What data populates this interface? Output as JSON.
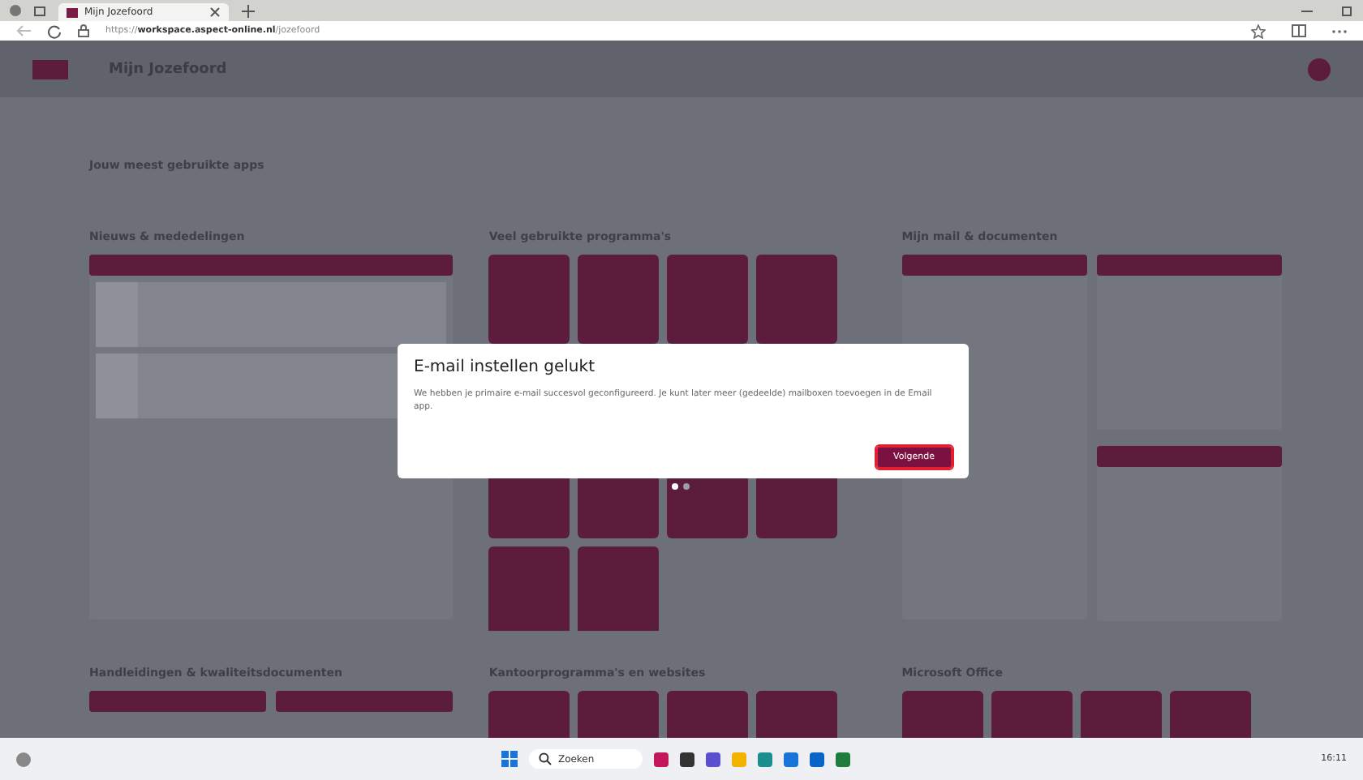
{
  "browser": {
    "tab_title": "Mijn Jozefoord",
    "url_prefix": "https://",
    "url_host": "workspace.aspect-online.nl",
    "url_path": "/jozefoord"
  },
  "app": {
    "title": "Mijn Jozefoord"
  },
  "favourites": {
    "heading": "Jouw meest gebruikte apps"
  },
  "columns": [
    {
      "heading": "Nieuws & mededelingen",
      "kind": "news"
    },
    {
      "heading": "Veel gebruikte programma's",
      "kind": "tiles"
    },
    {
      "heading": "Mijn mail & documenten",
      "kind": "mail"
    }
  ],
  "bottom_sections": [
    {
      "heading": "Handleidingen & kwaliteitsdocumenten",
      "kind": "bars"
    },
    {
      "heading": "Kantoorprogramma's en websites",
      "kind": "tiles"
    },
    {
      "heading": "Microsoft Office",
      "kind": "tiles"
    }
  ],
  "dialog": {
    "title": "E-mail instellen gelukt",
    "body": "We hebben je primaire e-mail succesvol geconfigureerd. Je kunt later meer (gedeelde) mailboxen toevoegen in de Email app.",
    "button": "Volgende"
  },
  "pager": [
    {
      "selected": true
    },
    {
      "selected": false
    }
  ],
  "taskbar": {
    "search_placeholder": "Zoeken",
    "time": "16:11"
  }
}
